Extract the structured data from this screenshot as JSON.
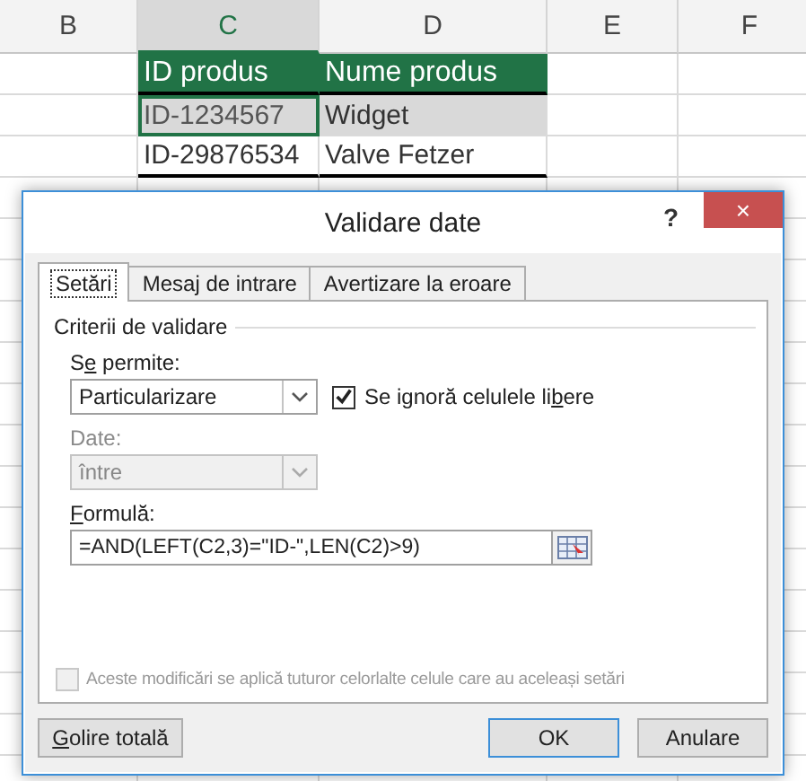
{
  "sheet": {
    "columns": [
      {
        "label": "B",
        "selected": false
      },
      {
        "label": "C",
        "selected": true
      },
      {
        "label": "D",
        "selected": false
      },
      {
        "label": "E",
        "selected": false
      },
      {
        "label": "F",
        "selected": false
      }
    ],
    "rows": [
      {
        "cells": [
          "",
          "ID produs",
          "Nume produs",
          "",
          ""
        ],
        "kind": "header",
        "selected": false
      },
      {
        "cells": [
          "",
          "ID-1234567",
          "Widget",
          "",
          ""
        ],
        "kind": "data",
        "selected": true
      },
      {
        "cells": [
          "",
          "ID-29876534",
          "Valve Fetzer",
          "",
          ""
        ],
        "kind": "data",
        "selected": false
      }
    ]
  },
  "dialog": {
    "title": "Validare date",
    "help": "?",
    "close": "×",
    "tabs": [
      {
        "label": "Setări",
        "selected": true
      },
      {
        "label": "Mesaj de intrare",
        "selected": false
      },
      {
        "label": "Avertizare la eroare",
        "selected": false
      }
    ],
    "group_title": "Criterii de validare",
    "allow": {
      "label": "Se permite:",
      "value": "Particularizare",
      "disabled": false
    },
    "ignore_blank": {
      "label": "Se ignoră celulele libere",
      "checked": true,
      "disabled": false
    },
    "data": {
      "label": "Date:",
      "value": "între",
      "disabled": true
    },
    "formula": {
      "label": "Formulă:",
      "value": "=AND(LEFT(C2,3)=\"ID-\",LEN(C2)>9)"
    },
    "apply_all": {
      "label": "Aceste modificări se aplică tuturor celorlalte celule care au aceleași setări",
      "checked": false,
      "disabled": true
    },
    "buttons": [
      {
        "label": "Golire totală",
        "default": false
      },
      {
        "label": "OK",
        "default": true
      },
      {
        "label": "Anulare",
        "default": false
      }
    ]
  }
}
